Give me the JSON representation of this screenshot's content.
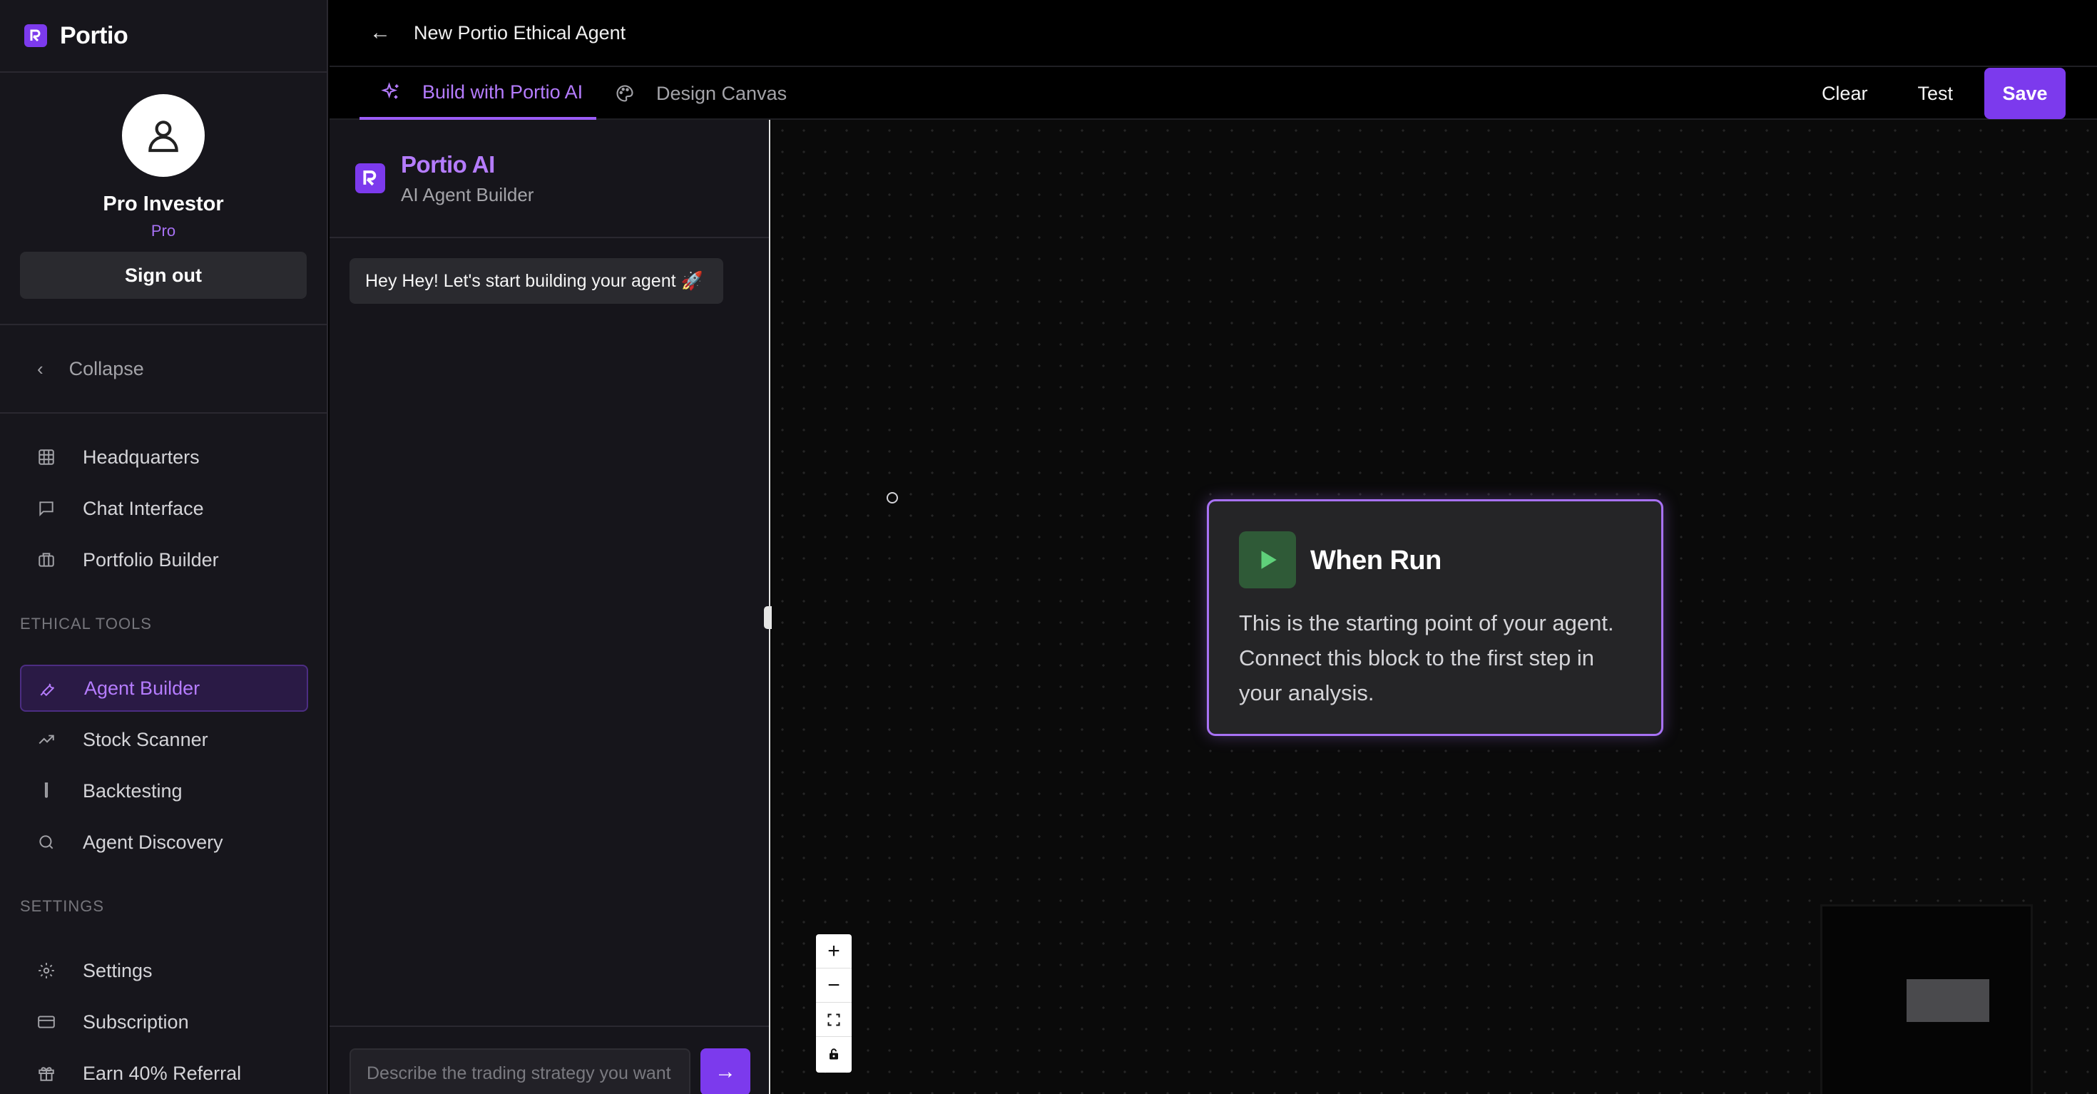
{
  "brand": {
    "name": "Portio",
    "accent": "#7c3aed",
    "accent_text": "#b57cff"
  },
  "profile": {
    "name": "Pro Investor",
    "plan": "Pro",
    "sign_out": "Sign out"
  },
  "sidebar": {
    "collapse_label": "Collapse",
    "main_items": [
      {
        "label": "Headquarters",
        "icon": "grid-icon"
      },
      {
        "label": "Chat Interface",
        "icon": "chat-icon"
      },
      {
        "label": "Portfolio Builder",
        "icon": "briefcase-icon"
      }
    ],
    "ethical_tools_label": "ETHICAL TOOLS",
    "ethical_tools_items": [
      {
        "label": "Agent Builder",
        "icon": "wrench-icon",
        "active": true
      },
      {
        "label": "Stock Scanner",
        "icon": "trending-up-icon"
      },
      {
        "label": "Backtesting",
        "icon": "test-tube-icon"
      },
      {
        "label": "Agent Discovery",
        "icon": "search-icon"
      }
    ],
    "settings_label": "SETTINGS",
    "settings_items": [
      {
        "label": "Settings",
        "icon": "gear-icon"
      },
      {
        "label": "Subscription",
        "icon": "card-icon"
      },
      {
        "label": "Earn 40% Referral",
        "icon": "gift-icon"
      }
    ]
  },
  "header": {
    "title": "New Portio Ethical Agent",
    "tabs": [
      {
        "label": "Build with Portio AI",
        "active": true
      },
      {
        "label": "Design Canvas",
        "active": false
      }
    ],
    "actions": {
      "clear": "Clear",
      "test": "Test",
      "save": "Save"
    }
  },
  "chat": {
    "title": "Portio AI",
    "subtitle": "AI Agent Builder",
    "messages": [
      "Hey Hey! Let's start building your agent 🚀"
    ],
    "input_placeholder": "Describe the trading strategy you want"
  },
  "canvas": {
    "node": {
      "title": "When Run",
      "description": "This is the starting point of your agent. Connect this block to the first step in your analysis."
    },
    "zoom_controls": [
      "zoom-in",
      "zoom-out",
      "fit-view",
      "lock"
    ]
  }
}
